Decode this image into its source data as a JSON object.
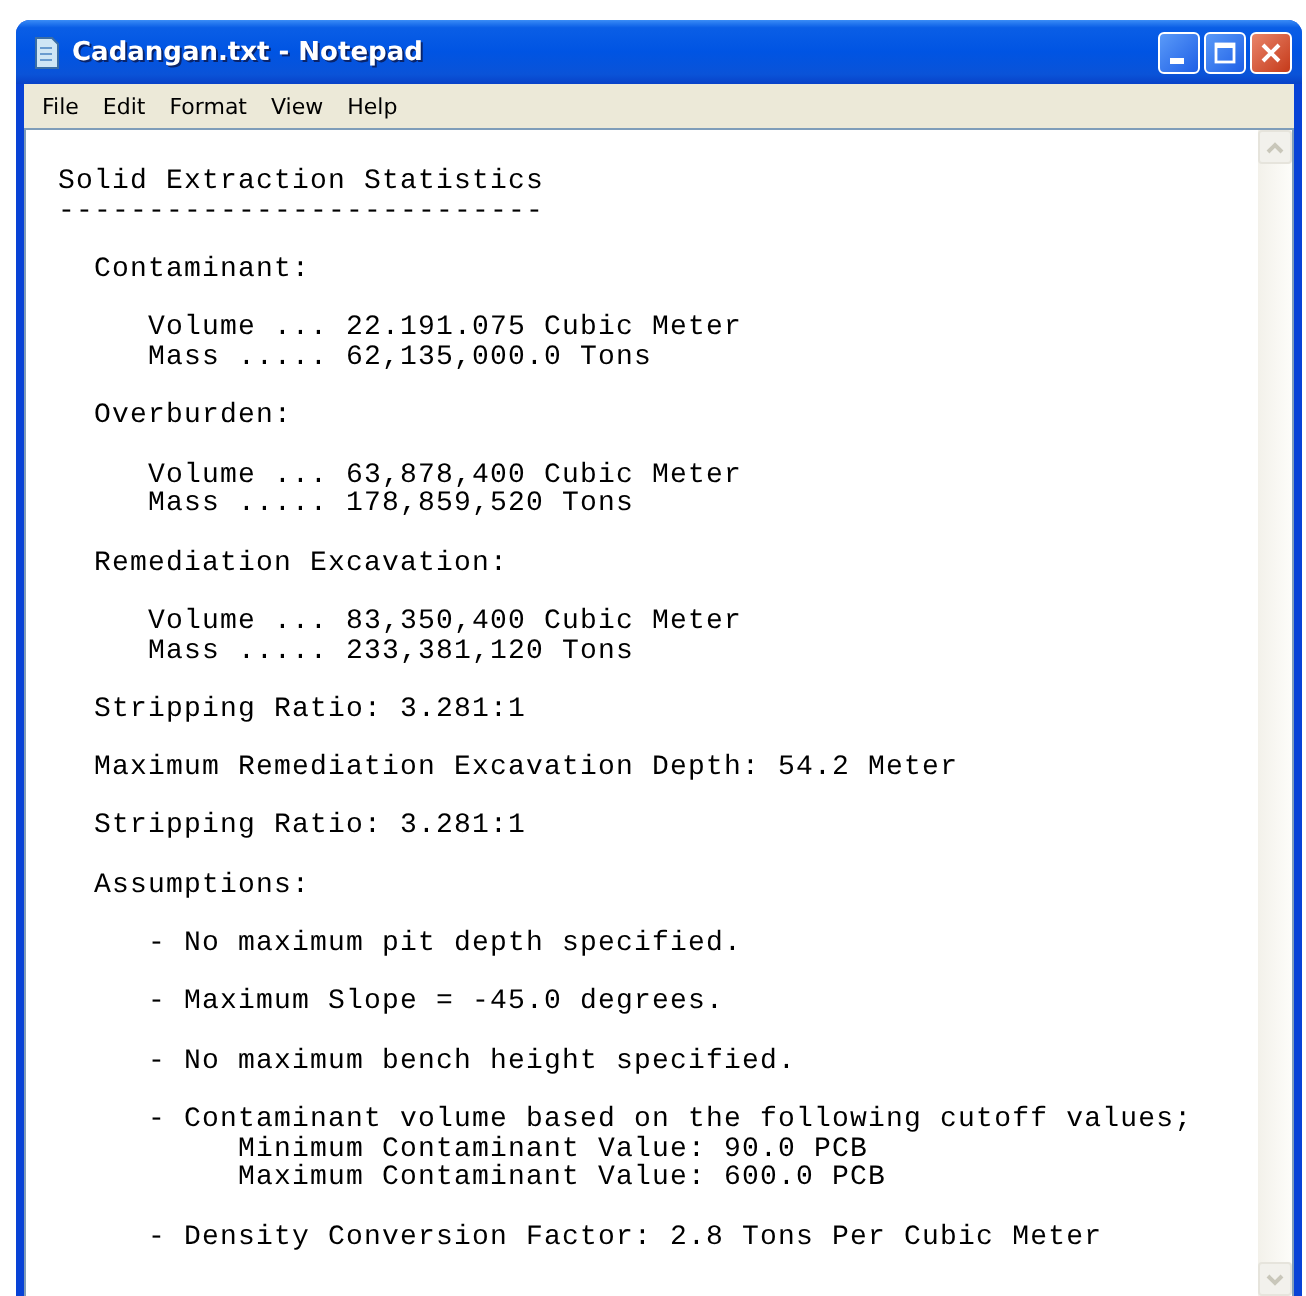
{
  "window": {
    "title": "Cadangan.txt - Notepad"
  },
  "menu": [
    "File",
    "Edit",
    "Format",
    "View",
    "Help"
  ],
  "document": {
    "heading": "Solid Extraction Statistics",
    "rule": "---------------------------",
    "groups": [
      {
        "label": "Contaminant:",
        "lines": [
          "Volume ... 22.191.075 Cubic Meter",
          "Mass ..... 62,135,000.0 Tons"
        ]
      },
      {
        "label": "Overburden:",
        "lines": [
          "Volume ... 63,878,400 Cubic Meter",
          "Mass ..... 178,859,520 Tons"
        ]
      },
      {
        "label": "Remediation Excavation:",
        "lines": [
          "Volume ... 83,350,400 Cubic Meter",
          "Mass ..... 233,381,120 Tons"
        ]
      }
    ],
    "stats": [
      "Stripping Ratio: 3.281:1",
      "Maximum Remediation Excavation Depth: 54.2 Meter",
      "Stripping Ratio: 3.281:1"
    ],
    "assumptions": {
      "label": "Assumptions:",
      "items": [
        {
          "text": "- No maximum pit depth specified."
        },
        {
          "text": "- Maximum Slope = -45.0 degrees."
        },
        {
          "text": "- No maximum bench height specified."
        },
        {
          "text": "- Contaminant volume based on the following cutoff values;",
          "details": [
            "Minimum Contaminant Value: 90.0 PCB",
            "Maximum Contaminant Value: 600.0 PCB"
          ]
        },
        {
          "text": "- Density Conversion Factor: 2.8 Tons Per Cubic Meter"
        }
      ]
    }
  }
}
